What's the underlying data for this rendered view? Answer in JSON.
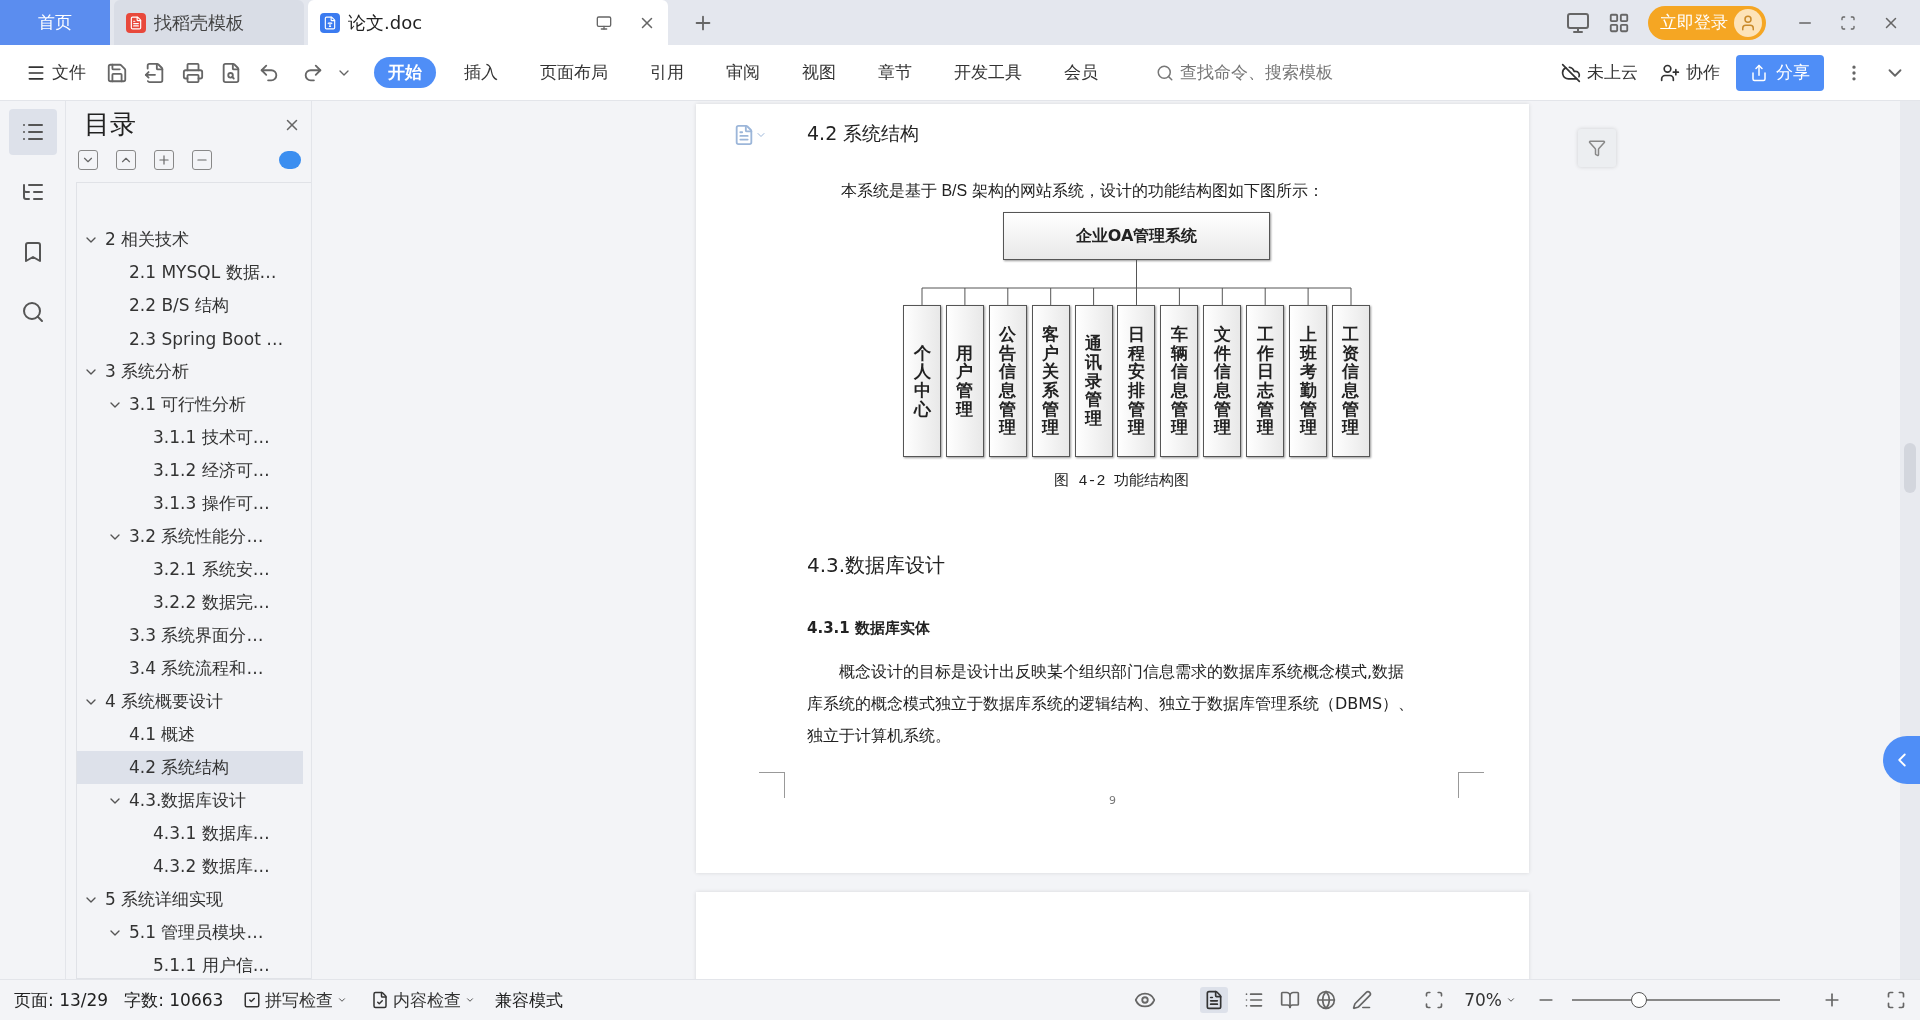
{
  "title_bar": {
    "home_tab": "首页",
    "tabs": [
      {
        "label": "找稻壳模板",
        "kind": "template",
        "selected": false
      },
      {
        "label": "论文.doc",
        "kind": "document",
        "selected": true
      }
    ],
    "login_button": "立即登录"
  },
  "toolbar": {
    "file_menu": "文件",
    "ribbon_tabs": [
      {
        "label": "开始",
        "selected": true
      },
      {
        "label": "插入",
        "selected": false
      },
      {
        "label": "页面布局",
        "selected": false
      },
      {
        "label": "引用",
        "selected": false
      },
      {
        "label": "审阅",
        "selected": false
      },
      {
        "label": "视图",
        "selected": false
      },
      {
        "label": "章节",
        "selected": false
      },
      {
        "label": "开发工具",
        "selected": false
      },
      {
        "label": "会员",
        "selected": false
      }
    ],
    "search": {
      "placeholder": "查找命令、搜索模板"
    },
    "cloud": "未上云",
    "collaborate": "协作",
    "share": "分享"
  },
  "sidebar": {
    "title": "目录",
    "toc": [
      {
        "label": "2 相关技术",
        "expanded": true,
        "selected": false,
        "children": [
          {
            "label": "2.1 MYSQL 数据…",
            "selected": false
          },
          {
            "label": "2.2 B/S 结构",
            "selected": false
          },
          {
            "label": "2.3 Spring Boot …",
            "selected": false
          }
        ]
      },
      {
        "label": "3 系统分析",
        "expanded": true,
        "selected": false,
        "children": [
          {
            "label": "3.1 可行性分析",
            "expanded": true,
            "selected": false,
            "children": [
              {
                "label": "3.1.1 技术可…",
                "selected": false
              },
              {
                "label": "3.1.2 经济可…",
                "selected": false
              },
              {
                "label": "3.1.3 操作可…",
                "selected": false
              }
            ]
          },
          {
            "label": "3.2 系统性能分…",
            "expanded": true,
            "selected": false,
            "children": [
              {
                "label": "3.2.1  系统安…",
                "selected": false
              },
              {
                "label": "3.2.2  数据完…",
                "selected": false
              }
            ]
          },
          {
            "label": "3.3 系统界面分…",
            "selected": false
          },
          {
            "label": "3.4 系统流程和…",
            "selected": false
          }
        ]
      },
      {
        "label": "4 系统概要设计",
        "expanded": true,
        "selected": false,
        "children": [
          {
            "label": "4.1 概述",
            "selected": false
          },
          {
            "label": "4.2 系统结构",
            "selected": true
          },
          {
            "label": "4.3.数据库设计",
            "expanded": true,
            "selected": false,
            "children": [
              {
                "label": "4.3.1 数据库…",
                "selected": false
              },
              {
                "label": "4.3.2 数据库…",
                "selected": false
              }
            ]
          }
        ]
      },
      {
        "label": "5 系统详细实现",
        "expanded": true,
        "selected": false,
        "children": [
          {
            "label": "5.1  管理员模块…",
            "expanded": true,
            "selected": false,
            "children": [
              {
                "label": "5.1.1  用户信…",
                "selected": false
              }
            ]
          }
        ]
      }
    ]
  },
  "document": {
    "heading": "4.2 系统结构",
    "intro": "本系统是基于 B/S 架构的网站系统，设计的功能结构图如下图所示：",
    "diagram": {
      "root": "企业OA管理系统",
      "modules": [
        "个人中心",
        "用户管理",
        "公告信息管理",
        "客户关系管理",
        "通讯录管理",
        "日程安排管理",
        "车辆信息管理",
        "文件信息管理",
        "工作日志管理",
        "上班考勤管理",
        "工资信息管理"
      ]
    },
    "caption": "图 4-2 功能结构图",
    "section_heading": "4.3.数据库设计",
    "subsection_heading": "4.3.1 数据库实体",
    "paragraph": "概念设计的目标是设计出反映某个组织部门信息需求的数据库系统概念模式,数据库系统的概念模式独立于数据库系统的逻辑结构、独立于数据库管理系统（DBMS）、独立于计算机系统。",
    "page_number": "9"
  },
  "status_bar": {
    "page": "页面: 13/29",
    "words": "字数: 10663",
    "spell_check": "拼写检查",
    "content_check": "内容检查",
    "compat_mode": "兼容模式",
    "zoom": "70%",
    "zoom_slider": {
      "level": 0.32
    }
  }
}
